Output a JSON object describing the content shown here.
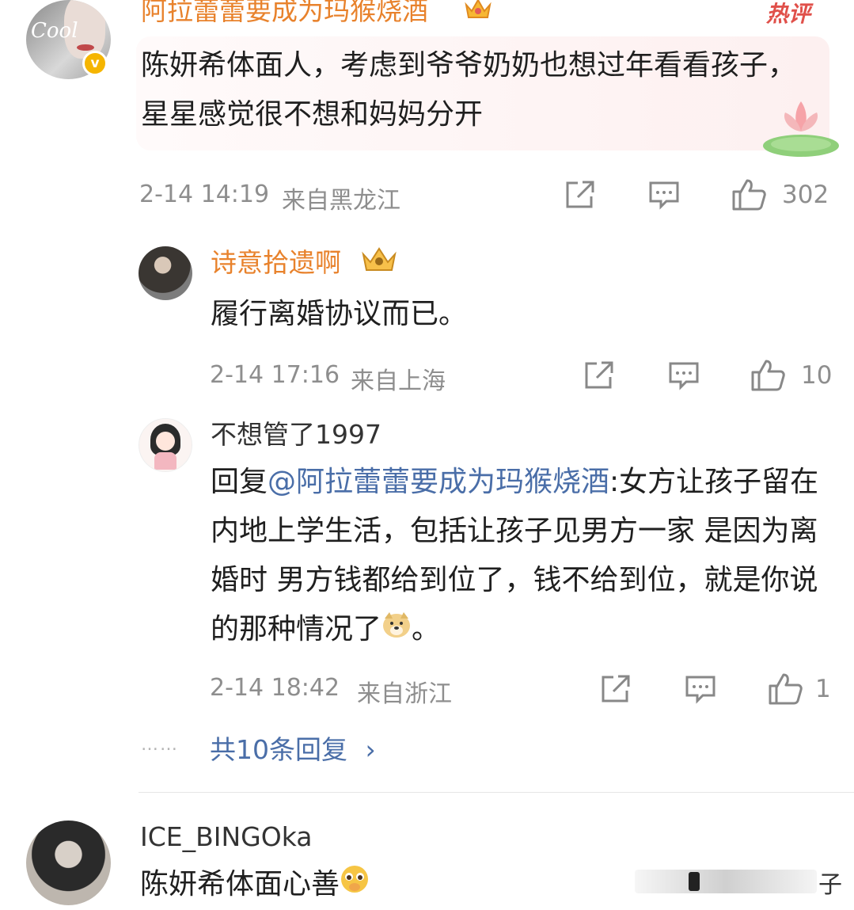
{
  "comments": [
    {
      "username": "阿拉蕾蕾要成为玛猴烧酒",
      "hot_badge": "热评",
      "avatar_text": "Cool",
      "text": "陈妍希体面人，考虑到爷爷奶奶也想过年看看孩子，星星感觉很不想和妈妈分开",
      "time": "2-14 14:19",
      "location": "来自黑龙江",
      "likes": "302"
    },
    {
      "username": "诗意拾遗啊",
      "text": "履行离婚协议而已。",
      "time": "2-14 17:16",
      "location": "来自上海",
      "likes": "10"
    },
    {
      "username": "不想管了1997",
      "reply_prefix": "回复",
      "reply_mention": "@阿拉蕾蕾要成为玛猴烧酒",
      "text": ":女方让孩子留在内地上学生活，包括让孩子见男方一家 是因为离婚时 男方钱都给到位了，钱不给到位，就是你说的那种情况了",
      "text_end": "。",
      "time": "2-14 18:42",
      "location": "来自浙江",
      "likes": "1"
    },
    {
      "username": "ICE_BINGOka",
      "text": "陈妍希体面心善",
      "trailing_char": "子"
    }
  ],
  "more_replies": {
    "dots": "……",
    "label": "共10条回复",
    "chevron": "›"
  },
  "colors": {
    "username_orange": "#e8822c",
    "mention_blue": "#4a6ea8",
    "meta_gray": "#8e8e8e",
    "hot_red": "#e0504a"
  },
  "icons": [
    "share-icon",
    "comment-icon",
    "like-icon",
    "verified-badge-icon",
    "crown-badge-icon",
    "lotus-decoration-icon",
    "doge-emoji-icon",
    "pleading-emoji-icon"
  ]
}
